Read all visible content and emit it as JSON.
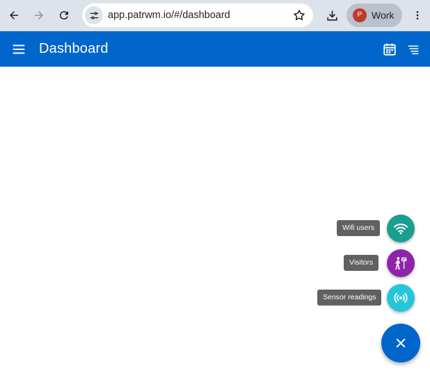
{
  "browser": {
    "url": "app.patrwm.io/#/dashboard",
    "profile": {
      "label": "Work",
      "initial": "P",
      "avatar_color": "#c0392b"
    }
  },
  "appbar": {
    "title": "Dashboard",
    "color": "#0066cc"
  },
  "speed_dial": {
    "actions": [
      {
        "tooltip": "Wifi users",
        "icon": "wifi-icon",
        "color": "#1a9e8f"
      },
      {
        "tooltip": "Visitors",
        "icon": "visitor-icon",
        "color": "#8e24aa"
      },
      {
        "tooltip": "Sensor readings",
        "icon": "sensor-icon",
        "color": "#26c6da"
      }
    ],
    "main_fab": {
      "icon": "close-icon",
      "color": "#0066cc"
    }
  }
}
